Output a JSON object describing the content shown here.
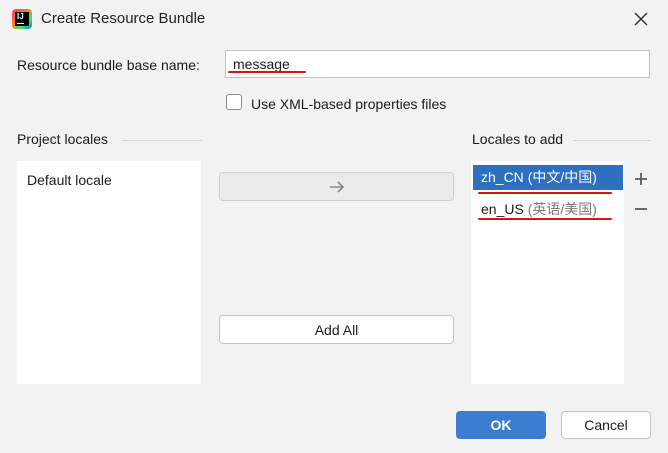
{
  "window": {
    "title": "Create Resource Bundle"
  },
  "form": {
    "base_name_label": "Resource bundle base name:",
    "base_name_value": "message",
    "xml_checkbox_label": "Use XML-based properties files",
    "xml_checkbox_checked": false
  },
  "project_locales": {
    "title": "Project locales",
    "items": [
      "Default locale"
    ]
  },
  "locales_to_add": {
    "title": "Locales to add",
    "items": [
      {
        "code": "zh_CN",
        "name": "(中文/中国)",
        "selected": true
      },
      {
        "code": "en_US",
        "name": "(英语/美国)",
        "selected": false
      }
    ]
  },
  "buttons": {
    "add_all": "Add All",
    "ok": "OK",
    "cancel": "Cancel"
  },
  "icons": {
    "app": "intellij-idea-icon",
    "close": "close-icon",
    "move_right": "arrow-right-icon",
    "add": "plus-icon",
    "remove": "minus-icon"
  },
  "colors": {
    "selection": "#2f6fbf",
    "primary_button": "#3b7ed1",
    "annotation_underline": "#e01010"
  }
}
